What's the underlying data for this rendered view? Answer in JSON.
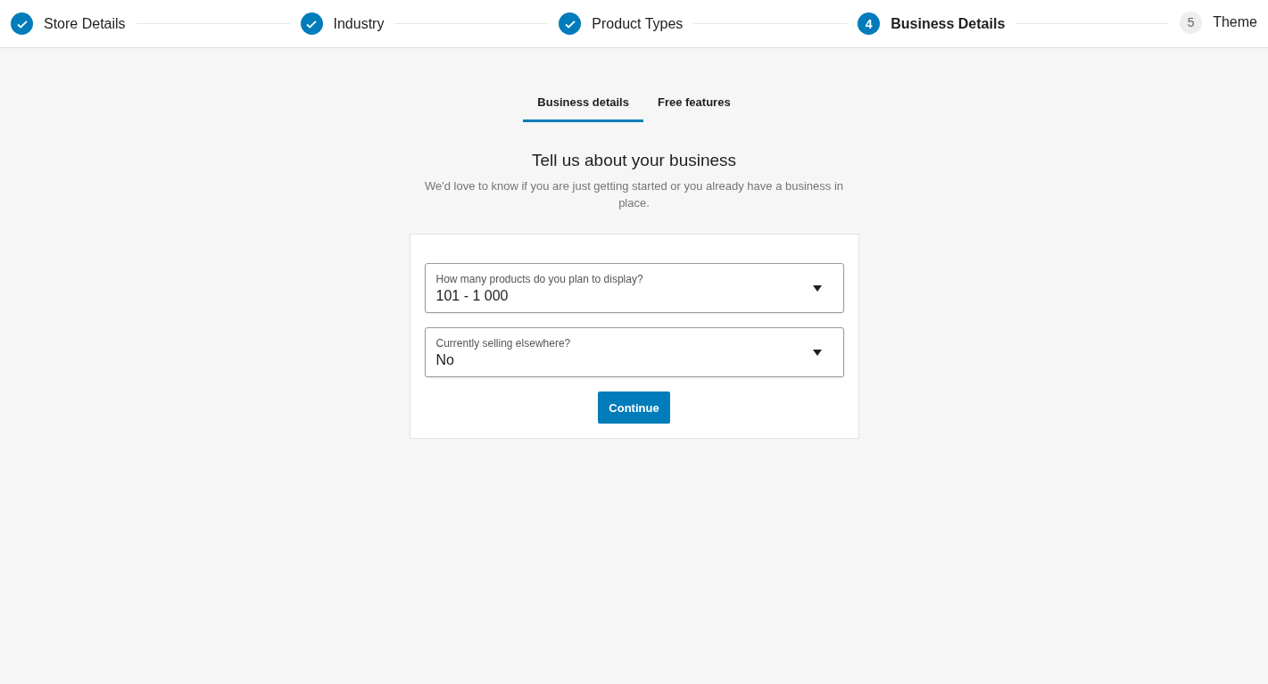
{
  "stepper": {
    "steps": [
      {
        "label": "Store Details",
        "completed": true,
        "selected": false
      },
      {
        "label": "Industry",
        "completed": true,
        "selected": false
      },
      {
        "label": "Product Types",
        "completed": true,
        "selected": false
      },
      {
        "label": "Business Details",
        "number": "4",
        "completed": false,
        "selected": true
      },
      {
        "label": "Theme",
        "number": "5",
        "completed": false,
        "selected": false
      }
    ]
  },
  "tabs": [
    {
      "label": "Business details",
      "selected": true
    },
    {
      "label": "Free features",
      "selected": false
    }
  ],
  "heading": "Tell us about your business",
  "subheading": "We'd love to know if you are just getting started or you already have a business in place.",
  "fields": [
    {
      "label": "How many products do you plan to display?",
      "value": "101 - 1 000"
    },
    {
      "label": "Currently selling elsewhere?",
      "value": "No"
    }
  ],
  "button": "Continue"
}
